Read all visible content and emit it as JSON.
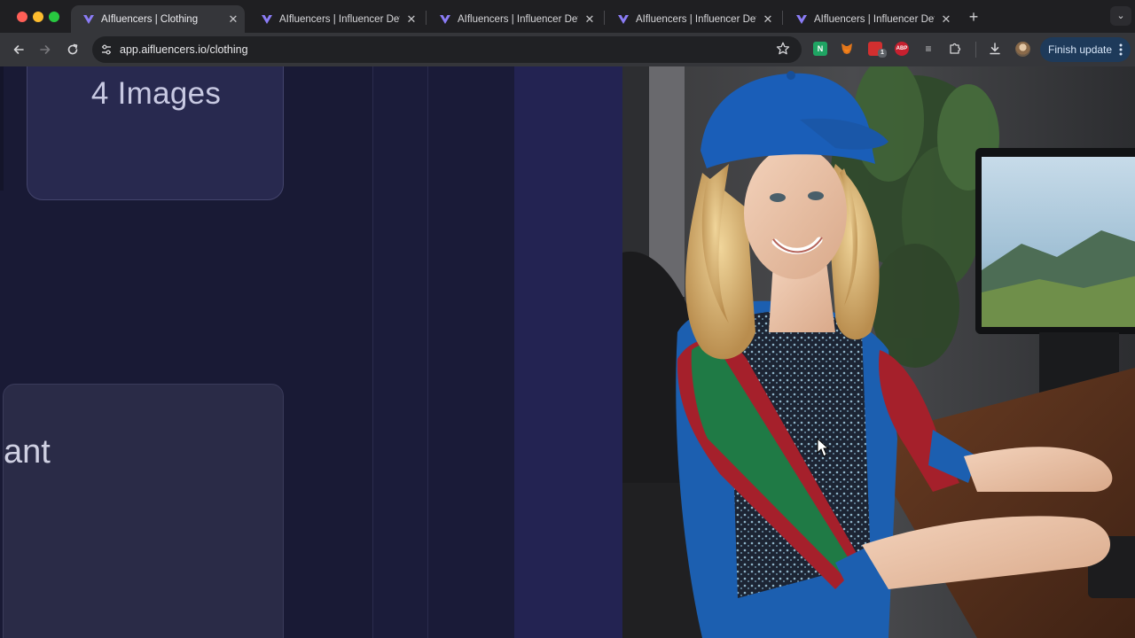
{
  "browser": {
    "tabs": [
      {
        "title": "AIfluencers | Clothing",
        "active": true
      },
      {
        "title": "AIfluencers | Influencer Detail",
        "active": false
      },
      {
        "title": "AIfluencers | Influencer Detail",
        "active": false
      },
      {
        "title": "AIfluencers | Influencer Detail",
        "active": false
      },
      {
        "title": "AIfluencers | Influencer Detail",
        "active": false
      }
    ],
    "url": "app.aifluencers.io/clothing",
    "finish_update_label": "Finish update",
    "extensions": [
      {
        "name": "n-extension-icon",
        "glyph": "N",
        "color": "#1fa463"
      },
      {
        "name": "metamask-fox-icon",
        "glyph": "",
        "color": "#e2761b"
      },
      {
        "name": "red-extension-icon",
        "glyph": "",
        "color": "#d22f2f",
        "badge": "1"
      },
      {
        "name": "adblock-plus-icon",
        "glyph": "ABP",
        "color": "#c7202f"
      },
      {
        "name": "list-extension-icon",
        "glyph": "≡",
        "color": "#5f6368"
      }
    ],
    "accent_color": "#1e3a5a"
  },
  "page": {
    "images_card_label": "4 Images",
    "bottom_card_label": "ant"
  }
}
